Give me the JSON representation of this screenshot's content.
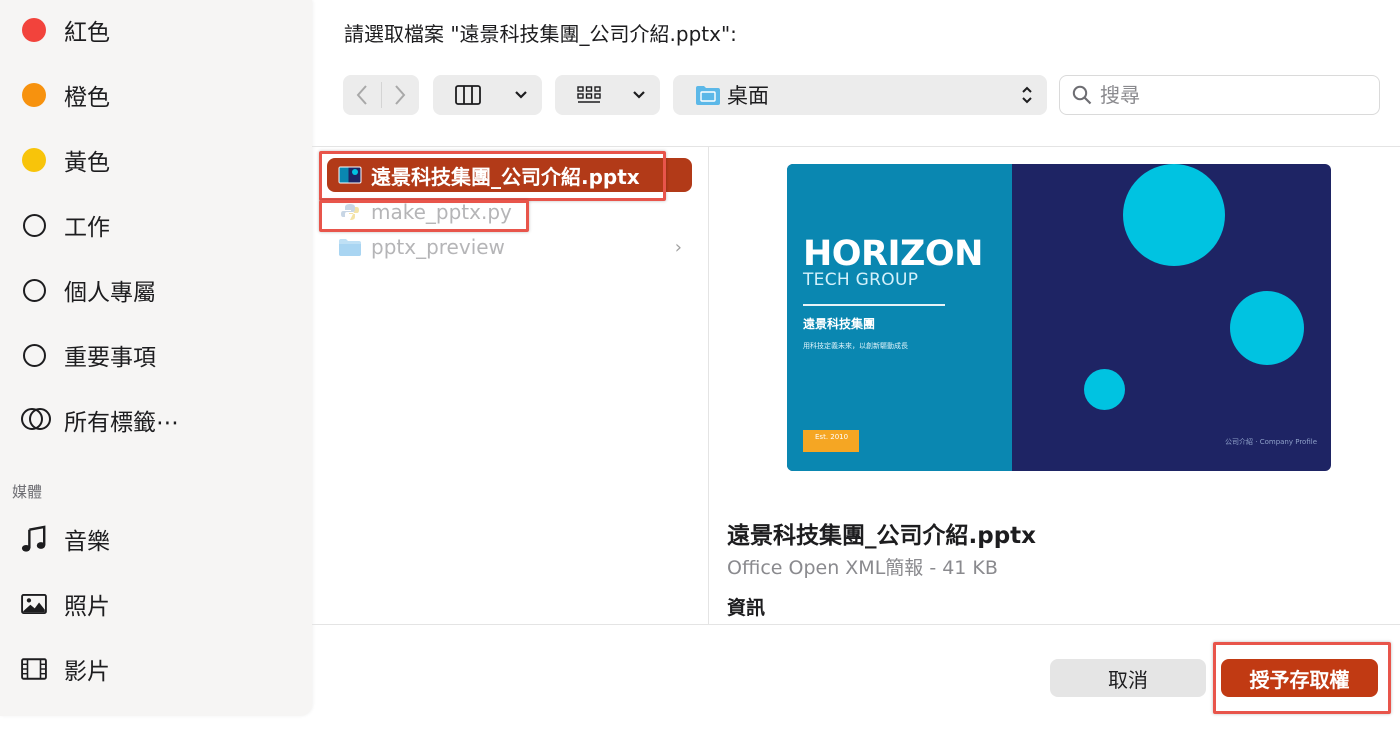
{
  "dialog": {
    "title": "請選取檔案 \"遠景科技集團_公司介紹.pptx\":"
  },
  "sidebar": {
    "tags": [
      {
        "label": "紅色",
        "color": "#f2433c",
        "icon": "red-dot-icon"
      },
      {
        "label": "橙色",
        "color": "#f7920e",
        "icon": "orange-dot-icon"
      },
      {
        "label": "黃色",
        "color": "#f8c40a",
        "icon": "yellow-dot-icon"
      },
      {
        "label": "工作",
        "icon": "tag-ring-icon"
      },
      {
        "label": "個人專屬",
        "icon": "tag-ring-icon"
      },
      {
        "label": "重要事項",
        "icon": "tag-ring-icon"
      },
      {
        "label": "所有標籤⋯",
        "icon": "all-tags-icon"
      }
    ],
    "media_section_label": "媒體",
    "media": [
      {
        "label": "音樂",
        "icon": "music-icon"
      },
      {
        "label": "照片",
        "icon": "photo-icon"
      },
      {
        "label": "影片",
        "icon": "film-icon"
      }
    ]
  },
  "toolbar": {
    "location": "桌面",
    "search_placeholder": "搜尋"
  },
  "files": [
    {
      "name": "遠景科技集團_公司介紹.pptx",
      "icon": "pptx-file-icon",
      "selected": true
    },
    {
      "name": "make_pptx.py",
      "icon": "python-file-icon",
      "selected": false
    },
    {
      "name": "pptx_preview",
      "icon": "folder-icon",
      "selected": false
    }
  ],
  "preview": {
    "slide": {
      "title": "HORIZON",
      "subtitle": "TECH GROUP",
      "chinese_title": "遠景科技集團",
      "tagline": "用科技定義未來，以創新驅動成長",
      "badge": "Est. 2010",
      "footer": "公司介紹 · Company Profile",
      "accent_color": "#00c3e1",
      "left_color": "#0a87b1",
      "right_color": "#1e2464",
      "badge_color": "#f5a623"
    },
    "file_name": "遠景科技集團_公司介紹.pptx",
    "file_kind": "Office Open XML簡報 - 41 KB",
    "info_label": "資訊"
  },
  "buttons": {
    "cancel": "取消",
    "grant": "授予存取權"
  }
}
